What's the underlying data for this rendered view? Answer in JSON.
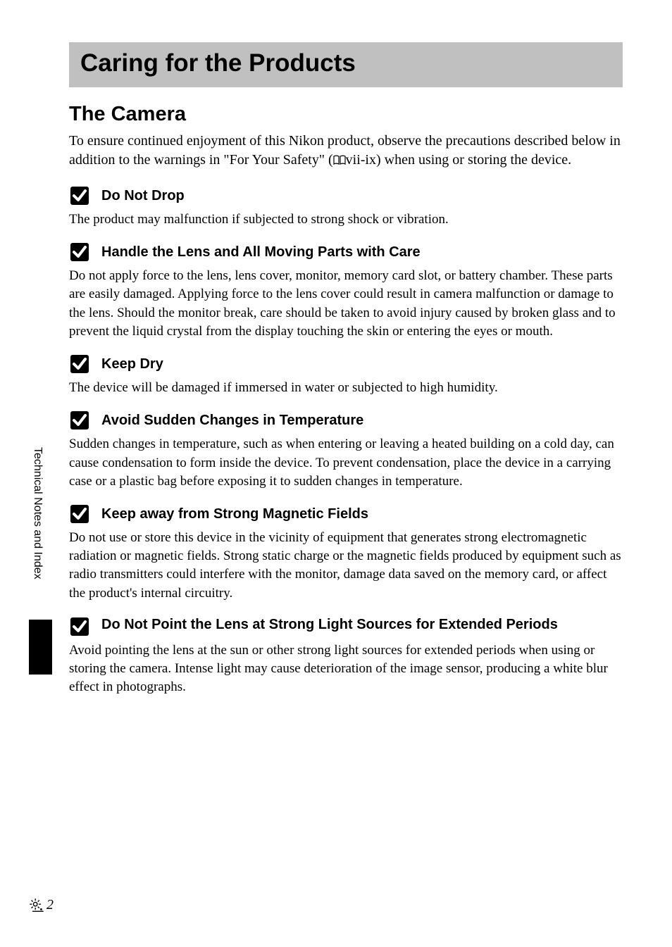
{
  "pageTitle": "Caring for the Products",
  "sectionTitle": "The Camera",
  "introText": "To ensure continued enjoyment of this Nikon product, observe the precautions described below in addition to the warnings in \"For Your Safety\" (",
  "introRef": "vii-ix) when using or storing the device.",
  "cautions": [
    {
      "title": "Do Not Drop",
      "body": "The product may malfunction if subjected to strong shock or vibration."
    },
    {
      "title": "Handle the Lens and All Moving Parts with Care",
      "body": "Do not apply force to the lens, lens cover, monitor, memory card slot, or battery chamber. These parts are easily damaged. Applying force to the lens cover could result in camera malfunction or damage to the lens. Should the monitor break, care should be taken to avoid injury caused by broken glass and to prevent the liquid crystal from the display touching the skin or entering the eyes or mouth."
    },
    {
      "title": "Keep Dry",
      "body": "The device will be damaged if immersed in water or subjected to high humidity."
    },
    {
      "title": "Avoid Sudden Changes in Temperature",
      "body": "Sudden changes in temperature, such as when entering or leaving a heated building on a cold day, can cause condensation to form inside the device. To prevent condensation, place the device in a carrying case or a plastic bag before exposing it to sudden changes in temperature."
    },
    {
      "title": "Keep away from Strong Magnetic Fields",
      "body": "Do not use or store this device in the vicinity of equipment that generates strong electromagnetic radiation or magnetic fields. Strong static charge or the magnetic fields produced by equipment such as radio transmitters could interfere with the monitor, damage data saved on the memory card, or affect the product's internal circuitry."
    },
    {
      "title": "Do Not Point the Lens at Strong Light Sources for Extended Periods",
      "body": "Avoid pointing the lens at the sun or other strong light sources for extended periods when using or storing the camera. Intense light may cause deterioration of the image sensor, producing a white blur effect in photographs."
    }
  ],
  "sideTab": "Technical Notes and Index",
  "pageNumber": "2"
}
